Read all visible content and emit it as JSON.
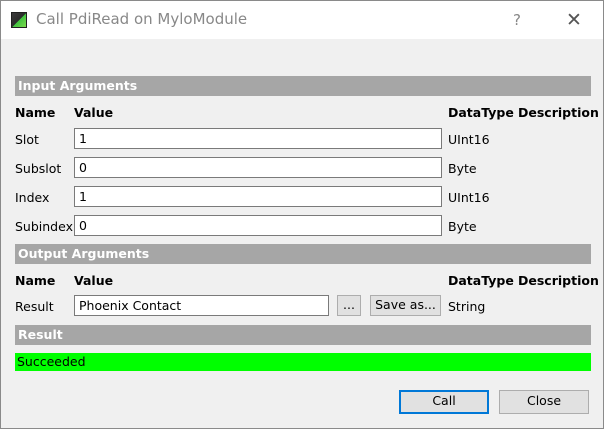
{
  "window": {
    "title": "Call PdiRead on MyloModule",
    "help_label": "?",
    "close_label": "✕"
  },
  "input_section": {
    "title": "Input Arguments",
    "headers": {
      "name": "Name",
      "value": "Value",
      "datatype": "DataType",
      "description": "Description"
    },
    "rows": [
      {
        "name": "Slot",
        "value": "1",
        "datatype": "UInt16"
      },
      {
        "name": "Subslot",
        "value": "0",
        "datatype": "Byte"
      },
      {
        "name": "Index",
        "value": "1",
        "datatype": "UInt16"
      },
      {
        "name": "Subindex",
        "value": "0",
        "datatype": "Byte"
      }
    ]
  },
  "output_section": {
    "title": "Output Arguments",
    "headers": {
      "name": "Name",
      "value": "Value",
      "datatype": "DataType",
      "description": "Description"
    },
    "rows": [
      {
        "name": "Result",
        "value": "Phoenix Contact",
        "browse_label": "...",
        "save_label": "Save as...",
        "datatype": "String"
      }
    ]
  },
  "result_section": {
    "title": "Result",
    "status": "Succeeded",
    "status_color": "#00ff00"
  },
  "buttons": {
    "call_label": "Call",
    "close_label": "Close"
  }
}
